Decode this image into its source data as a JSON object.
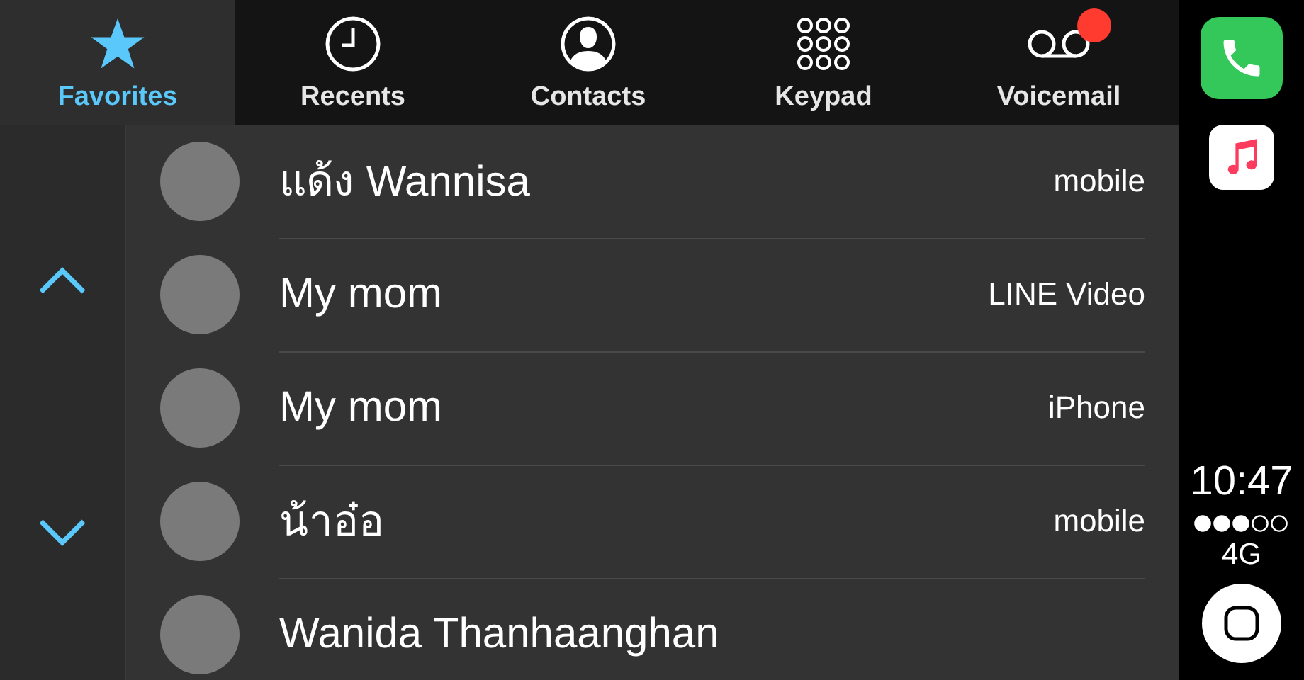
{
  "tabs": [
    {
      "label": "Favorites",
      "kind": "star",
      "selected": true,
      "badge": false
    },
    {
      "label": "Recents",
      "kind": "clock",
      "selected": false,
      "badge": false
    },
    {
      "label": "Contacts",
      "kind": "person",
      "selected": false,
      "badge": false
    },
    {
      "label": "Keypad",
      "kind": "keypad",
      "selected": false,
      "badge": false
    },
    {
      "label": "Voicemail",
      "kind": "voicemail",
      "selected": false,
      "badge": true
    }
  ],
  "favorites": [
    {
      "name": "แด้ง Wannisa",
      "label": "mobile"
    },
    {
      "name": "My mom",
      "label": "LINE Video"
    },
    {
      "name": "My mom",
      "label": "iPhone"
    },
    {
      "name": "น้าอ๋อ",
      "label": "mobile"
    },
    {
      "name": "Wanida Thanhaanghan"
    }
  ],
  "dock": {
    "apps": [
      {
        "kind": "phone"
      },
      {
        "kind": "music"
      }
    ],
    "time": "10:47",
    "network": "4G"
  }
}
